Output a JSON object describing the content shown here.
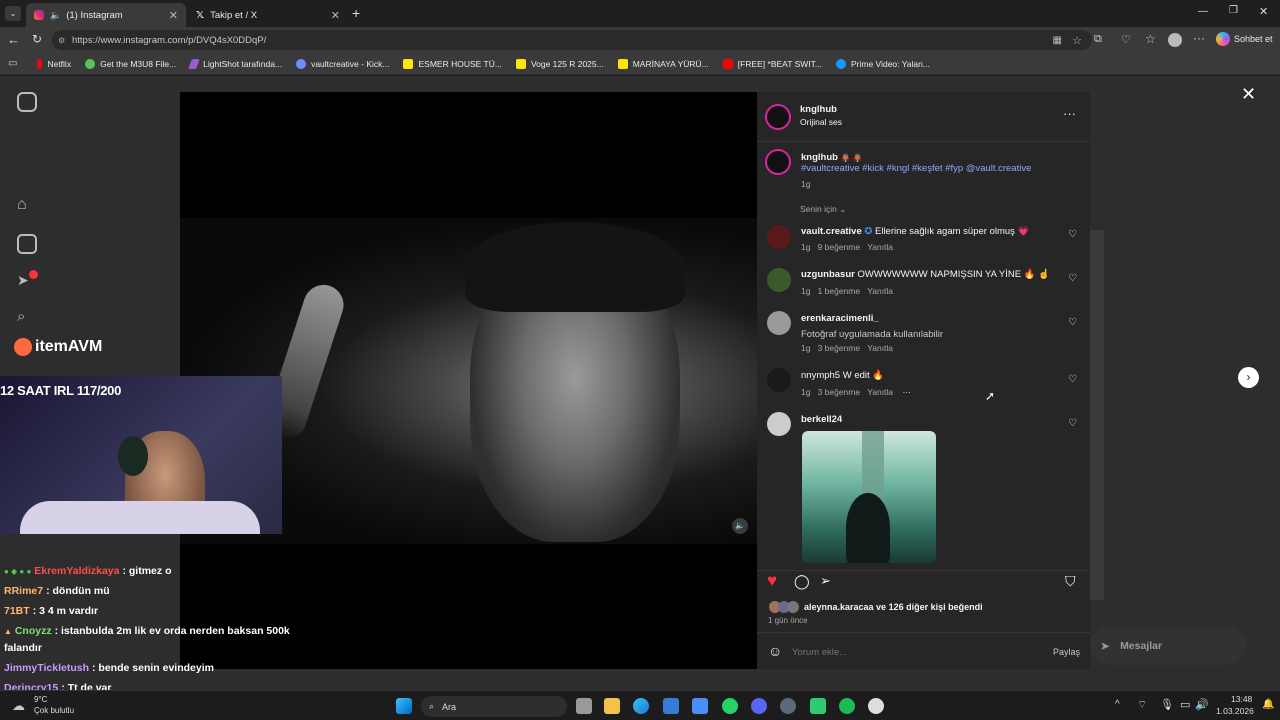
{
  "browser": {
    "tabs": [
      {
        "title": "(1) Instagram",
        "active": true
      },
      {
        "title": "Takip et / X",
        "active": false
      }
    ],
    "url": "https://www.instagram.com/p/DVQ4sX0DDqP/",
    "profile_button": "Sohbet et",
    "bookmarks": [
      "Netflix",
      "Get the M3U8 File...",
      "LightShot tarafında...",
      "vaultcreative - Kick...",
      "ESMER HOUSE TÜ...",
      "Voge 125 R 2025...",
      "MARİNAYA YÜRÜ...",
      "[FREE] *BEAT SWIT...",
      "Prime Video: Yalan..."
    ]
  },
  "post": {
    "author": "knglhub",
    "audio": "Orijinal ses",
    "caption_user": "knglhub",
    "caption_emoji": "🧛🏽‍♂️ 🧛🏽‍♂️",
    "caption_tags": "#vaultcreative #kick #kngl #keşfet #fyp @vault.creative",
    "caption_time": "1g",
    "sort_label": "Senin için",
    "comments": [
      {
        "user": "vault.creative",
        "verified": true,
        "text": "Ellerine sağlık agam süper olmuş 💗",
        "time": "1g",
        "likes": "9 beğenme",
        "reply": "Yanıtla"
      },
      {
        "user": "uzgunbasur",
        "text": "OWWWWWWW NAPMIŞSIN YA YİNE 🔥 ☝️",
        "time": "1g",
        "likes": "1 beğenme",
        "reply": "Yanıtla"
      },
      {
        "user": "erenkaracimenli_",
        "text": "Fotoğraf uygulamada kullanılabilir",
        "time": "1g",
        "likes": "3 beğenme",
        "reply": "Yanıtla"
      },
      {
        "user": "nnymph5",
        "text": "W edit 🔥",
        "time": "1g",
        "likes": "3 beğenme",
        "reply": "Yanıtla"
      },
      {
        "user": "berkell24",
        "text": "",
        "time": "",
        "likes": "",
        "reply": ""
      }
    ],
    "liked_by": "aleynna.karacaa ve 126 diğer kişi beğendi",
    "posted_ago": "1 gün önce",
    "comment_placeholder": "Yorum ekle...",
    "share_label": "Paylaş",
    "messages_label": "Mesajlar"
  },
  "stream": {
    "sponsor": "itemAVM",
    "title": "12 SAAT IRL 117/200",
    "chat": [
      {
        "name": "EkremYaldizkaya",
        "msg": ": gitmez o",
        "color": "#ff4d4d"
      },
      {
        "name": "RRime7",
        "msg": ": döndün mü",
        "color": "#ffb86b"
      },
      {
        "name": "71BT",
        "msg": ": 3 4 m vardır",
        "color": "#ffb86b"
      },
      {
        "name": "Cnoyzz",
        "msg": ": istanbulda 2m lik ev orda nerden baksan 500k",
        "color": "#7be37b"
      },
      {
        "name": "",
        "msg": "falandır",
        "color": "#ffffff"
      },
      {
        "name": "JimmyTickletush",
        "msg": ": bende senin evindeyim",
        "color": "#c89bff"
      },
      {
        "name": "Derincry15",
        "msg": ": Tt de var",
        "color": "#c89bff"
      }
    ]
  },
  "taskbar": {
    "weather_temp": "9°C",
    "weather_desc": "Çok bulutlu",
    "search": "Ara",
    "time": "13:48",
    "date": "1.03.2026"
  }
}
